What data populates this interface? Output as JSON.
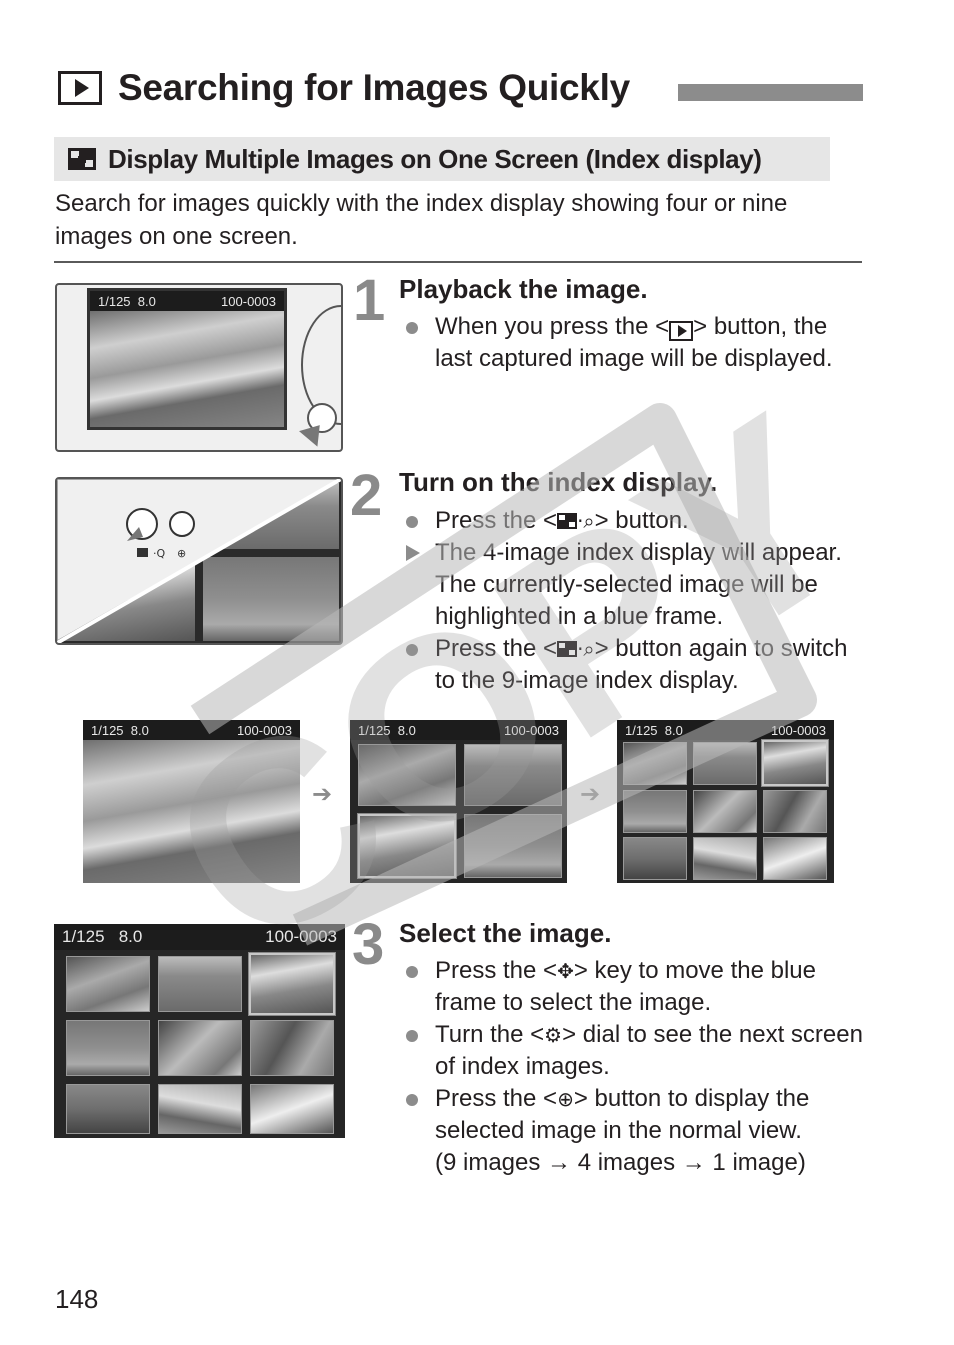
{
  "header": {
    "title_icon": "playback-icon",
    "title": "Searching for Images Quickly"
  },
  "section": {
    "icon": "index-display-icon",
    "title": "Display Multiple Images on One Screen (Index display)"
  },
  "intro": "Search for images quickly with the index display showing four or nine images on one screen.",
  "lcd_info": {
    "shutter": "1/125",
    "aperture": "8.0",
    "file_number": "100-0003"
  },
  "steps": [
    {
      "number": "1",
      "title": "Playback the image.",
      "bullets": [
        {
          "type": "dot",
          "pre": "When you press the <",
          "icon": "playback-icon",
          "post": "> button, the last captured image will be displayed."
        }
      ]
    },
    {
      "number": "2",
      "title": "Turn on the index display.",
      "bullets": [
        {
          "type": "dot",
          "pre": "Press the <",
          "icon": "index-reduce-icon",
          "post": "> button."
        },
        {
          "type": "result",
          "text": "The 4-image index display will appear. The currently-selected image will be highlighted in a blue frame."
        },
        {
          "type": "dot",
          "pre": "Press the <",
          "icon": "index-reduce-icon",
          "post": "> button again to switch to the 9-image index display."
        }
      ]
    },
    {
      "number": "3",
      "title": "Select the image.",
      "bullets": [
        {
          "type": "dot",
          "pre": "Press the <",
          "icon": "cross-keys-icon",
          "post": "> key to move the blue frame to select the image."
        },
        {
          "type": "dot",
          "pre": "Turn the <",
          "icon": "main-dial-icon",
          "post": "> dial to see the next screen of index images."
        },
        {
          "type": "dot",
          "pre": "Press the <",
          "icon": "magnify-icon",
          "post": "> button to display the selected image in the normal view."
        },
        {
          "type": "note",
          "text": "(9 images → 4 images → 1 image)"
        }
      ]
    }
  ],
  "flow_arrow": "➔",
  "glyphs": {
    "zoom_out": "·🔍︎",
    "cross": "✥",
    "dial": "⚙",
    "zoom_in": "⊕"
  },
  "watermark": "COPY",
  "page_number": "148"
}
